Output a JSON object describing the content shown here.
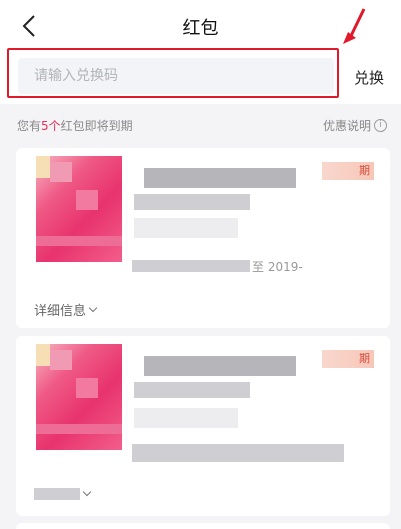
{
  "header": {
    "title": "红包",
    "back_icon": "chevron-left-icon"
  },
  "redeem": {
    "placeholder": "请输入兑换码",
    "button_label": "兑换"
  },
  "notice": {
    "prefix": "您有",
    "count": "5个",
    "suffix": "红包即将到期"
  },
  "policy": {
    "label": "优惠说明",
    "icon": "info-icon"
  },
  "cards": [
    {
      "tag_text": "期",
      "expiry_text": "至 2019-",
      "details_label": "详细信息"
    },
    {
      "tag_text": "期",
      "expiry_text": "",
      "details_label": ""
    }
  ],
  "colors": {
    "accent": "#e82d5a",
    "annotation": "#e0192b"
  }
}
